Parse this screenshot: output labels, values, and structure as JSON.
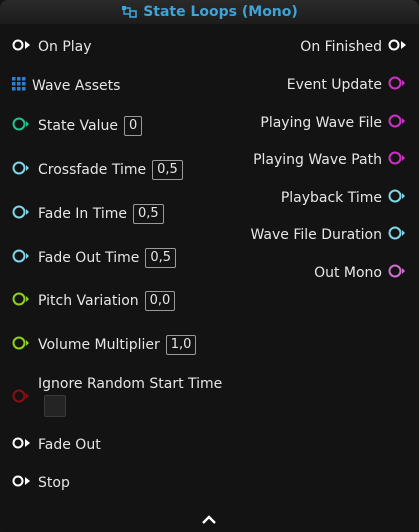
{
  "node": {
    "title": "State Loops (Mono)",
    "title_color": "#3fa3d6",
    "title_icon": "node-graph-icon"
  },
  "inputs": {
    "on_play": "On Play",
    "wave_assets": "Wave Assets",
    "state_value": "State Value",
    "state_value_val": "0",
    "crossfade_time": "Crossfade Time",
    "crossfade_time_val": "0,5",
    "fade_in_time": "Fade In Time",
    "fade_in_time_val": "0,5",
    "fade_out_time": "Fade Out Time",
    "fade_out_time_val": "0,5",
    "pitch_variation": "Pitch Variation",
    "pitch_variation_val": "0,0",
    "volume_multiplier": "Volume Multiplier",
    "volume_multiplier_val": "1,0",
    "ignore_random_start_time": "Ignore Random Start Time",
    "fade_out": "Fade Out",
    "stop": "Stop"
  },
  "outputs": {
    "on_finished": "On Finished",
    "event_update": "Event Update",
    "playing_wave_file": "Playing Wave File",
    "playing_wave_path": "Playing Wave Path",
    "playback_time": "Playback Time",
    "wave_file_duration": "Wave File Duration",
    "out_mono": "Out Mono"
  },
  "colors": {
    "exec": "#ffffff",
    "array": "#2f7fd1",
    "int": "#1fc48f",
    "float": "#7fd6e8",
    "float_green": "#8fd11f",
    "bool": "#8a1010",
    "event": "#d030c8",
    "audio": "#d070d0"
  }
}
